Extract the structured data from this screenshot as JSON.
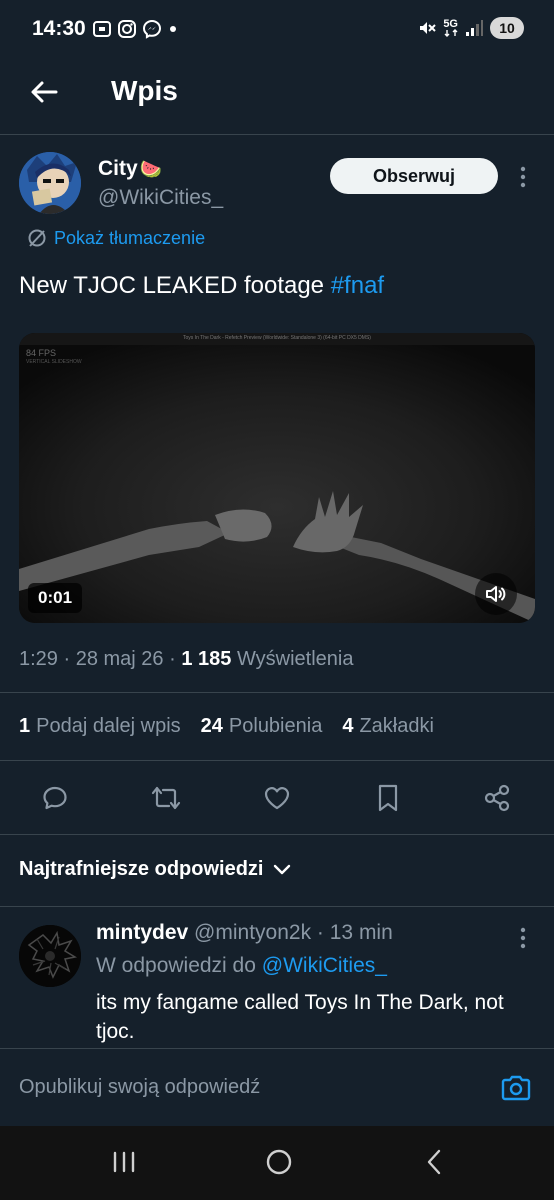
{
  "status_bar": {
    "time": "14:30",
    "network": "5G",
    "battery": "10"
  },
  "header": {
    "title": "Wpis"
  },
  "post": {
    "author_name": "City",
    "author_emoji": "🍉",
    "author_handle": "@WikiCities_",
    "follow_label": "Obserwuj",
    "translate_label": "Pokaż tłumaczenie",
    "text": "New TJOC LEAKED footage ",
    "hashtag": "#fnaf",
    "video": {
      "window_title": "Toys In The Dark - Refetch Preview (Worldwide: Standalone 3) (64-bit PC DX5 DMS)",
      "fps": "84 FPS",
      "fps_sub": "VERTICAL SLIDESHOW",
      "duration": "0:01"
    },
    "time": "1:29",
    "date": "28 maj 26",
    "views_count": "1 185",
    "views_label": "Wyświetlenia",
    "reposts_count": "1",
    "reposts_label": "Podaj dalej wpis",
    "likes_count": "24",
    "likes_label": "Polubienia",
    "bookmarks_count": "4",
    "bookmarks_label": "Zakładki"
  },
  "replies": {
    "sort_label": "Najtrafniejsze odpowiedzi",
    "items": [
      {
        "name": "mintydev",
        "handle": "@mintyon2k",
        "age": "13 min",
        "reply_to_prefix": "W odpowiedzi do ",
        "reply_to_handle": "@WikiCities_",
        "text": "its my fangame called Toys In The Dark, not tjoc."
      }
    ]
  },
  "compose": {
    "placeholder": "Opublikuj swoją odpowiedź"
  },
  "colors": {
    "background": "#15202b",
    "accent": "#1d9bf0",
    "secondary_text": "#8b98a5",
    "divider": "#38444d"
  }
}
